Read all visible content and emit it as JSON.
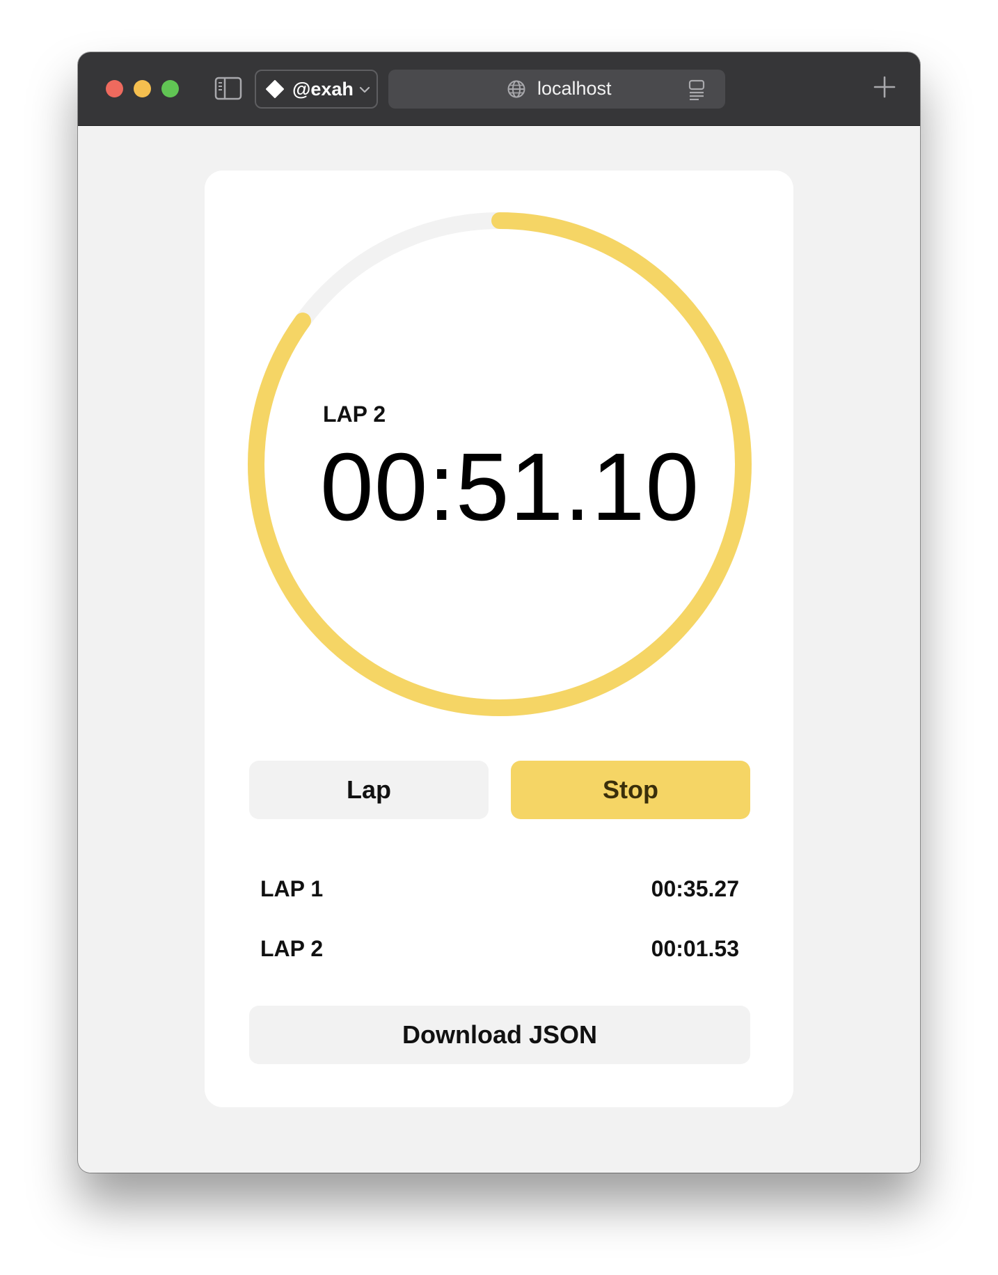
{
  "browser": {
    "profile_label": "@exah",
    "url": "localhost",
    "colors": {
      "close": "#ee6a5e",
      "minimize": "#f5bf4f",
      "zoom": "#61c554"
    }
  },
  "stopwatch": {
    "current_lap_label": "LAP 2",
    "current_time": "00:51.10",
    "progress_fraction": 0.85,
    "accent_color": "#f5d565",
    "track_color": "#f2f2f2"
  },
  "controls": {
    "lap_label": "Lap",
    "stop_label": "Stop"
  },
  "laps": [
    {
      "name": "LAP 1",
      "time": "00:35.27"
    },
    {
      "name": "LAP 2",
      "time": "00:01.53"
    }
  ],
  "download_label": "Download JSON"
}
